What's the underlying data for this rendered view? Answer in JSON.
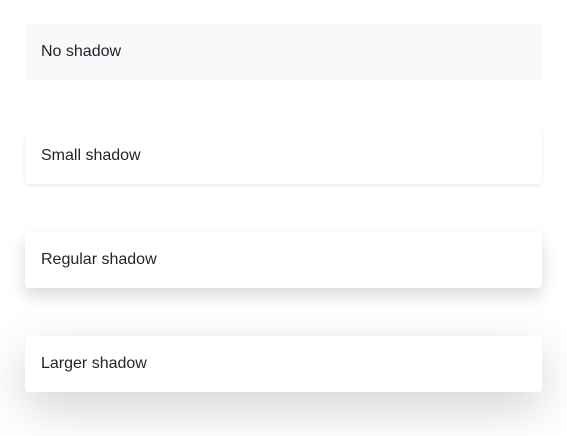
{
  "cards": [
    {
      "label": "No shadow"
    },
    {
      "label": "Small shadow"
    },
    {
      "label": "Regular shadow"
    },
    {
      "label": "Larger shadow"
    }
  ],
  "colors": {
    "page_background": "#ffffff",
    "no_shadow_background": "#f8f9fa",
    "text": "#212529"
  }
}
